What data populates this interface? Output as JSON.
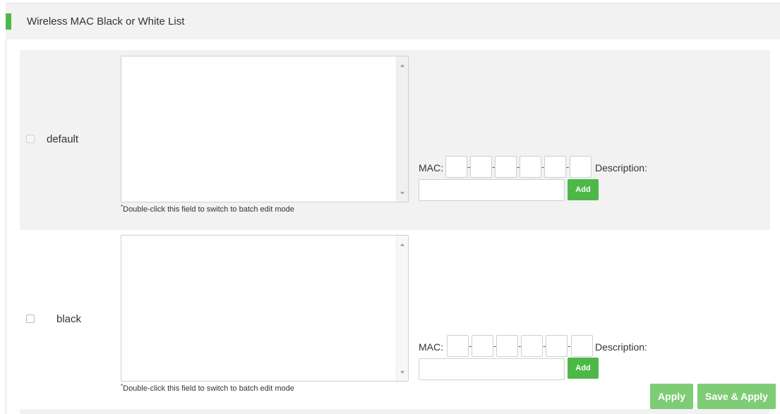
{
  "section": {
    "title": "Wireless MAC Black or White List",
    "accent_color": "#4db847"
  },
  "rows": [
    {
      "label": "default",
      "checked": false,
      "disabled": true,
      "hint_star": "*",
      "hint": "Double-click this field to switch to batch edit mode",
      "mac_label": "MAC:",
      "separator": "-",
      "description_label": "Description:",
      "add_label": "Add"
    },
    {
      "label": "black",
      "checked": false,
      "disabled": false,
      "hint_star": "*",
      "hint": "Double-click this field to switch to batch edit mode",
      "mac_label": "MAC:",
      "separator": "-",
      "description_label": "Description:",
      "add_label": "Add"
    }
  ],
  "footer": {
    "apply_label": "Apply",
    "save_apply_label": "Save & Apply",
    "button_color": "#7fcc76"
  },
  "icons": [
    "scroll-up-arrow-icon",
    "scroll-down-arrow-icon"
  ]
}
